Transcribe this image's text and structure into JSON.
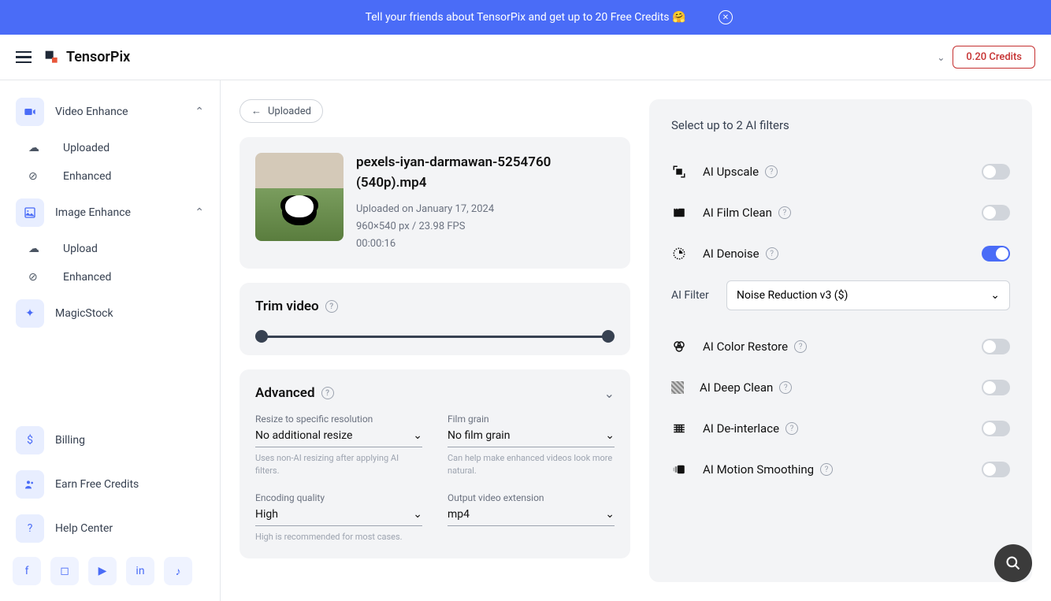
{
  "banner": {
    "text": "Tell your friends about TensorPix and get up to 20 Free Credits 🤗"
  },
  "header": {
    "brand": "TensorPix",
    "credits": "0.20 Credits"
  },
  "sidebar": {
    "video_enhance": "Video Enhance",
    "video_uploaded": "Uploaded",
    "video_enhanced": "Enhanced",
    "image_enhance": "Image Enhance",
    "image_upload": "Upload",
    "image_enhanced": "Enhanced",
    "magicstock": "MagicStock",
    "billing": "Billing",
    "earn": "Earn Free Credits",
    "help": "Help Center"
  },
  "back_button": "Uploaded",
  "video": {
    "filename": "pexels-iyan-darmawan-5254760 (540p).mp4",
    "uploaded": "Uploaded on January 17, 2024",
    "dimensions": "960×540 px / 23.98 FPS",
    "duration": "00:00:16"
  },
  "trim": {
    "title": "Trim video"
  },
  "advanced": {
    "title": "Advanced",
    "resize": {
      "label": "Resize to specific resolution",
      "value": "No additional resize",
      "hint": "Uses non-AI resizing after applying AI filters."
    },
    "grain": {
      "label": "Film grain",
      "value": "No film grain",
      "hint": "Can help make enhanced videos look more natural."
    },
    "encoding": {
      "label": "Encoding quality",
      "value": "High",
      "hint": "High is recommended for most cases."
    },
    "extension": {
      "label": "Output video extension",
      "value": "mp4"
    }
  },
  "filters": {
    "title": "Select up to 2 AI filters",
    "upscale": "AI Upscale",
    "filmclean": "AI Film Clean",
    "denoise": "AI Denoise",
    "denoise_select_label": "AI Filter",
    "denoise_select_value": "Noise Reduction v3 ($)",
    "colorrestore": "AI Color Restore",
    "deepclean": "AI Deep Clean",
    "deinterlace": "AI De-interlace",
    "motion": "AI Motion Smoothing"
  }
}
